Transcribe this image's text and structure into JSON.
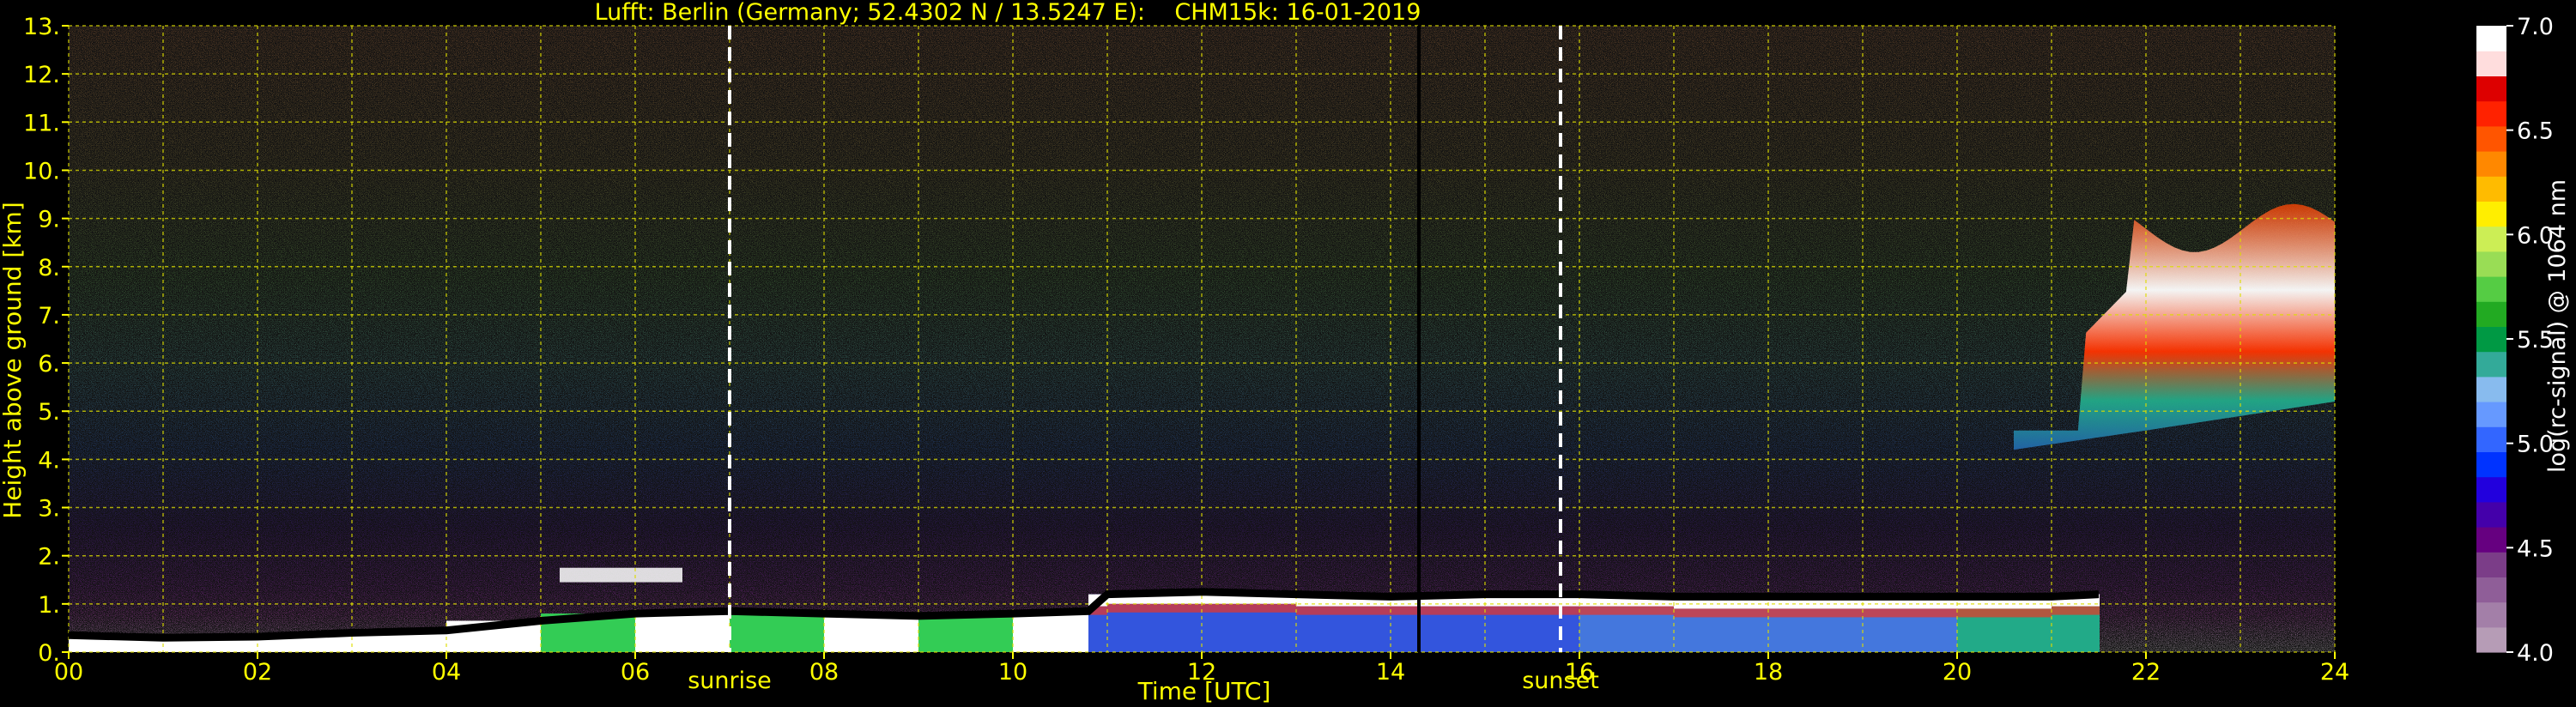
{
  "chart_data": {
    "type": "heatmap",
    "title": "Lufft: Berlin (Germany; 52.4302 N / 13.5247 E):    CHM15k: 16-01-2019",
    "xlabel": "Time [UTC]",
    "ylabel": "Height above ground [km]",
    "xlim": [
      0,
      24
    ],
    "ylim": [
      0,
      13
    ],
    "x_ticks": [
      "00",
      "02",
      "04",
      "06",
      "08",
      "10",
      "12",
      "14",
      "16",
      "18",
      "20",
      "22",
      "24"
    ],
    "y_ticks": [
      "0.",
      "1.",
      "2.",
      "3.",
      "4.",
      "5.",
      "6.",
      "7.",
      "8.",
      "9.",
      "10.",
      "11.",
      "12.",
      "13."
    ],
    "grid": true,
    "colorbar": {
      "label": "log(rc-signal) @ 1064 nm",
      "range": [
        4.0,
        7.0
      ],
      "ticks": [
        "4.0",
        "4.5",
        "5.0",
        "5.5",
        "6.0",
        "6.5",
        "7.0"
      ],
      "colors": [
        "#b69cb6",
        "#a37fa8",
        "#8f5e98",
        "#7b3d88",
        "#660080",
        "#4400aa",
        "#2200dd",
        "#0033ff",
        "#3366ff",
        "#6699ff",
        "#88bbee",
        "#33aa99",
        "#009944",
        "#22aa22",
        "#55cc44",
        "#99dd55",
        "#ccee55",
        "#ffee00",
        "#ffbb00",
        "#ff8800",
        "#ff5500",
        "#ff2200",
        "#dd0000",
        "#ffdddd",
        "#ffffff"
      ]
    },
    "annotations": [
      {
        "text": "sunrise",
        "x": 7.0
      },
      {
        "text": "sunset",
        "x": 15.8
      }
    ],
    "event_line": {
      "x": 14.3
    },
    "cloud_base_line": [
      {
        "x": 0.0,
        "y": 0.35
      },
      {
        "x": 1.0,
        "y": 0.3
      },
      {
        "x": 2.0,
        "y": 0.32
      },
      {
        "x": 3.0,
        "y": 0.4
      },
      {
        "x": 4.0,
        "y": 0.45
      },
      {
        "x": 5.0,
        "y": 0.65
      },
      {
        "x": 6.0,
        "y": 0.8
      },
      {
        "x": 7.0,
        "y": 0.85
      },
      {
        "x": 8.0,
        "y": 0.8
      },
      {
        "x": 9.0,
        "y": 0.75
      },
      {
        "x": 10.0,
        "y": 0.8
      },
      {
        "x": 10.8,
        "y": 0.85
      },
      {
        "x": 11.0,
        "y": 1.2
      },
      {
        "x": 12.0,
        "y": 1.25
      },
      {
        "x": 13.0,
        "y": 1.2
      },
      {
        "x": 14.0,
        "y": 1.15
      },
      {
        "x": 15.0,
        "y": 1.2
      },
      {
        "x": 16.0,
        "y": 1.2
      },
      {
        "x": 17.0,
        "y": 1.15
      },
      {
        "x": 18.0,
        "y": 1.15
      },
      {
        "x": 19.0,
        "y": 1.15
      },
      {
        "x": 20.0,
        "y": 1.15
      },
      {
        "x": 21.0,
        "y": 1.15
      },
      {
        "x": 21.5,
        "y": 1.2
      }
    ],
    "high_cloud_region": {
      "x": [
        20.6,
        24.0
      ],
      "y": [
        4.2,
        10.5
      ]
    }
  }
}
